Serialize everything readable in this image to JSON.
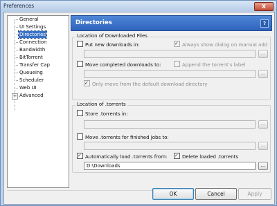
{
  "window": {
    "title": "Preferences",
    "close_glyph": "X"
  },
  "tree": {
    "items": [
      {
        "label": "General"
      },
      {
        "label": "UI Settings"
      },
      {
        "label": "Directories"
      },
      {
        "label": "Connection"
      },
      {
        "label": "Bandwidth"
      },
      {
        "label": "BitTorrent"
      },
      {
        "label": "Transfer Cap"
      },
      {
        "label": "Queueing"
      },
      {
        "label": "Scheduler"
      },
      {
        "label": "Web UI"
      },
      {
        "label": "Advanced"
      }
    ],
    "selected": "Directories",
    "expander_glyph": "+"
  },
  "header": {
    "title": "Directories",
    "help_glyph": "?"
  },
  "downloaded": {
    "group_title": "Location of Downloaded Files",
    "put_new_downloads": {
      "label": "Put new downloads in:",
      "checked": false
    },
    "always_show_dialog": {
      "label": "Always show dialog on manual add",
      "checked": true,
      "disabled": true
    },
    "put_path": {
      "value": "",
      "browse_label": "..."
    },
    "move_completed": {
      "label": "Move completed downloads to:",
      "checked": false
    },
    "append_label": {
      "label": "Append the torrent's label",
      "checked": false,
      "disabled": true
    },
    "move_path": {
      "value": "",
      "browse_label": "..."
    },
    "only_move_default": {
      "label": "Only move from the default download directory",
      "checked": true,
      "disabled": true
    }
  },
  "torrents": {
    "group_title": "Location of .torrents",
    "store_torrents": {
      "label": "Store .torrents in:",
      "checked": false
    },
    "store_path": {
      "value": "",
      "browse_label": "..."
    },
    "move_torrents": {
      "label": "Move .torrents for finished jobs to:",
      "checked": false
    },
    "move_path": {
      "value": "",
      "browse_label": "..."
    },
    "auto_load": {
      "label": "Automatically load .torrents from:",
      "checked": true
    },
    "delete_loaded": {
      "label": "Delete loaded .torrents",
      "checked": true
    },
    "auto_load_path": {
      "value": "D:\\Downloads",
      "browse_label": "..."
    }
  },
  "buttons": {
    "ok": "OK",
    "cancel": "Cancel",
    "apply": "Apply"
  }
}
